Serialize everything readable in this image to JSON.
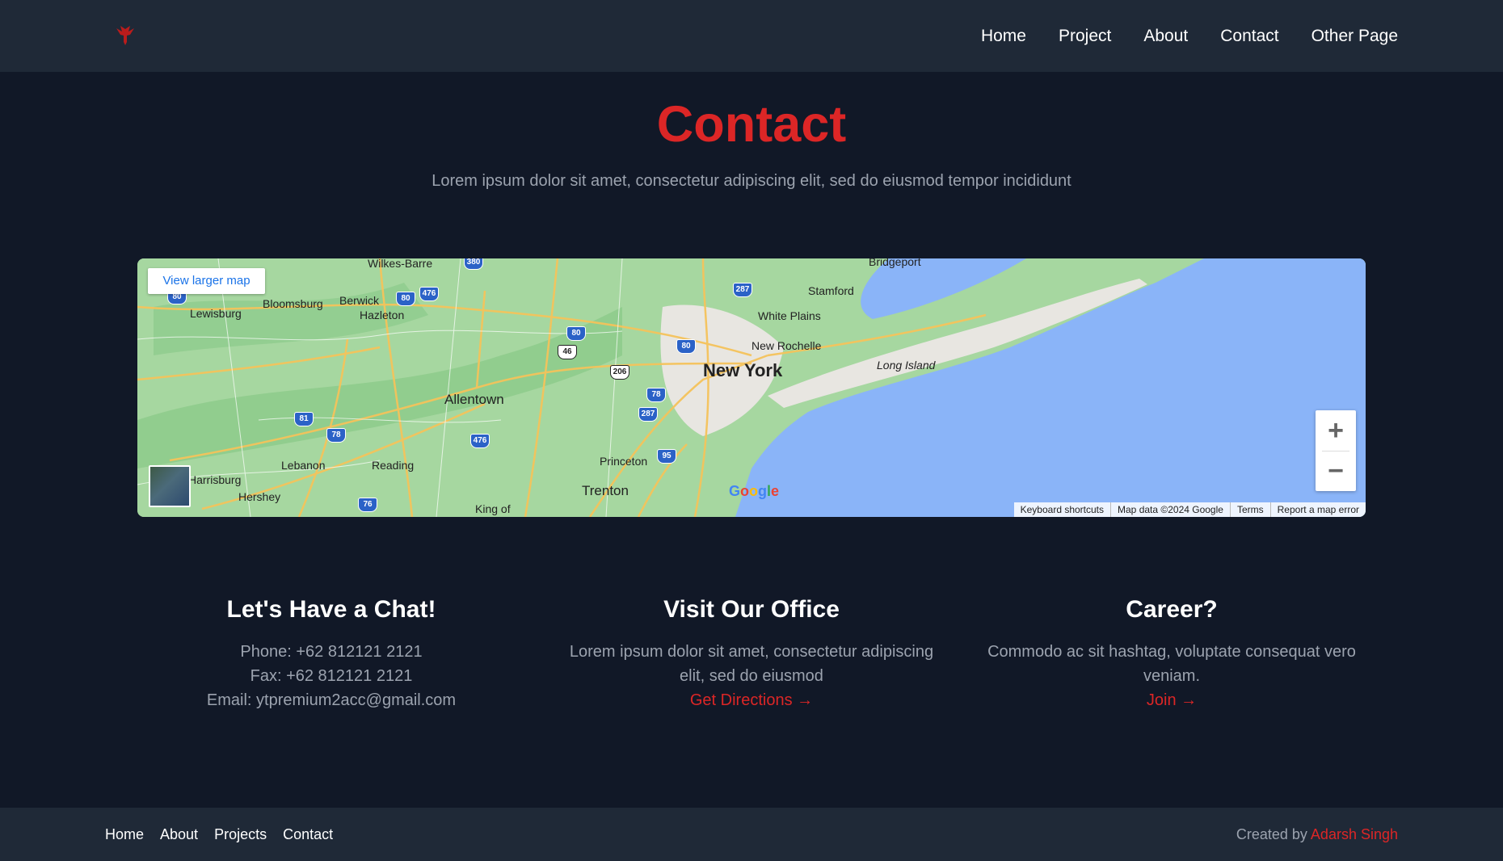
{
  "header": {
    "logo_icon": "red-bird-logo-icon",
    "nav": [
      {
        "label": "Home"
      },
      {
        "label": "Project"
      },
      {
        "label": "About"
      },
      {
        "label": "Contact"
      },
      {
        "label": "Other Page"
      }
    ]
  },
  "hero": {
    "title": "Contact",
    "subtitle": "Lorem ipsum dolor sit amet, consectetur adipiscing elit, sed do eiusmod tempor incididunt"
  },
  "map": {
    "view_larger": "View larger map",
    "zoom_in": "+",
    "zoom_out": "−",
    "google_logo": "Google",
    "footer": [
      "Keyboard shortcuts",
      "Map data ©2024 Google",
      "Terms",
      "Report a map error"
    ],
    "places": {
      "new_york": "New York",
      "allentown": "Allentown",
      "trenton": "Trenton",
      "princeton": "Princeton",
      "long_island": "Long Island",
      "stamford": "Stamford",
      "white_plains": "White Plains",
      "new_rochelle": "New Rochelle",
      "bridgeport": "Bridgeport",
      "wilkes_barre": "Wilkes-Barre",
      "bloomsburg": "Bloomsburg",
      "berwick": "Berwick",
      "hazleton": "Hazleton",
      "lewisburg": "Lewisburg",
      "lebanon": "Lebanon",
      "reading": "Reading",
      "harrisburg": "Harrisburg",
      "hershey": "Hershey",
      "king_of": "King of"
    },
    "shields": [
      "80",
      "80",
      "476",
      "380",
      "287",
      "80",
      "46",
      "80",
      "206",
      "78",
      "287",
      "81",
      "78",
      "476",
      "95",
      "76"
    ]
  },
  "info": {
    "chat": {
      "title": "Let's Have a Chat!",
      "phone": "Phone: +62 812121 2121",
      "fax": "Fax: +62 812121 2121",
      "email": "Email: ytpremium2acc@gmail.com"
    },
    "office": {
      "title": "Visit Our Office",
      "text": "Lorem ipsum dolor sit amet, consectetur adipiscing elit, sed do eiusmod",
      "link": "Get Directions →"
    },
    "career": {
      "title": "Career?",
      "text": "Commodo ac sit hashtag, voluptate consequat vero veniam.",
      "link": "Join →"
    }
  },
  "footer": {
    "links": [
      {
        "label": "Home"
      },
      {
        "label": "About"
      },
      {
        "label": "Projects"
      },
      {
        "label": "Contact"
      }
    ],
    "credit_prefix": "Created by ",
    "credit_name": "Adarsh Singh"
  },
  "colors": {
    "accent": "#dc2626",
    "background": "#111827",
    "bar": "#1f2937",
    "muted_text": "#9ca3af",
    "water": "#8ab4f8"
  }
}
